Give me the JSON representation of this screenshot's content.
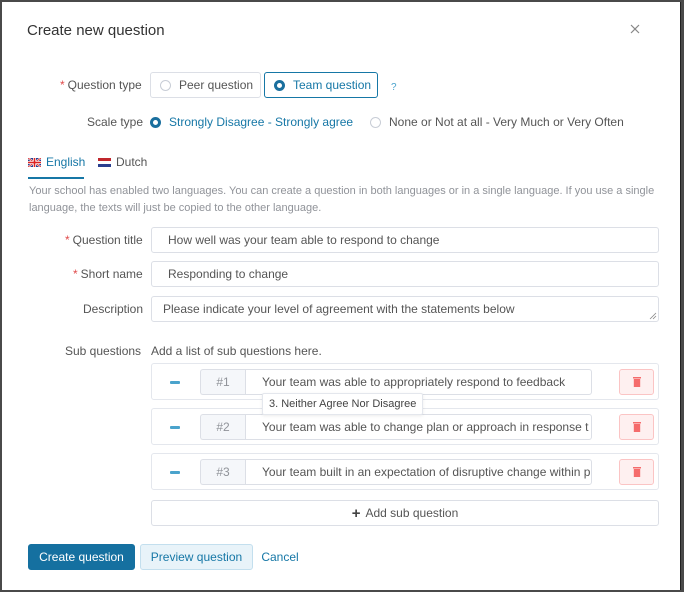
{
  "dialog": {
    "title": "Create new question",
    "close_icon": "close-icon"
  },
  "question_type": {
    "label": "Question type",
    "required": true,
    "options": [
      {
        "label": "Peer question",
        "selected": false
      },
      {
        "label": "Team question",
        "selected": true
      }
    ],
    "help": "?"
  },
  "scale_type": {
    "label": "Scale type",
    "options": [
      {
        "label": "Strongly Disagree - Strongly agree",
        "selected": true
      },
      {
        "label": "None or Not at all - Very Much or Very Often",
        "selected": false
      }
    ]
  },
  "language_tabs": [
    {
      "label": "English",
      "icon": "uk-flag-icon",
      "active": true
    },
    {
      "label": "Dutch",
      "icon": "nl-flag-icon",
      "active": false
    }
  ],
  "info_text": "Your school has enabled two languages. You can create a question in both languages or in a single language. If you use a single language, the texts will just be copied to the other language.",
  "fields": {
    "question_title": {
      "label": "Question title",
      "required": true,
      "value": "How well was your team able to respond to change"
    },
    "short_name": {
      "label": "Short name",
      "required": true,
      "value": "Responding to change"
    },
    "description": {
      "label": "Description",
      "required": false,
      "value": "Please indicate your level of agreement with the statements below"
    }
  },
  "sub_questions": {
    "label": "Sub questions",
    "hint": "Add a list of sub questions here.",
    "items": [
      {
        "number": "#1",
        "value": "Your team was able to appropriately respond to feedback"
      },
      {
        "number": "#2",
        "value": "Your team was able to change plan or approach in response t"
      },
      {
        "number": "#3",
        "value": "Your team built in an expectation of disruptive change within p"
      }
    ],
    "tooltip": "3. Neither Agree Nor Disagree",
    "add_label": "Add sub question"
  },
  "footer": {
    "create_label": "Create question",
    "preview_label": "Preview question",
    "cancel_label": "Cancel"
  },
  "colors": {
    "accent": "#1677a6",
    "primary_button": "#1570a0",
    "danger": "#f56c6c",
    "required": "#e04b4b"
  }
}
